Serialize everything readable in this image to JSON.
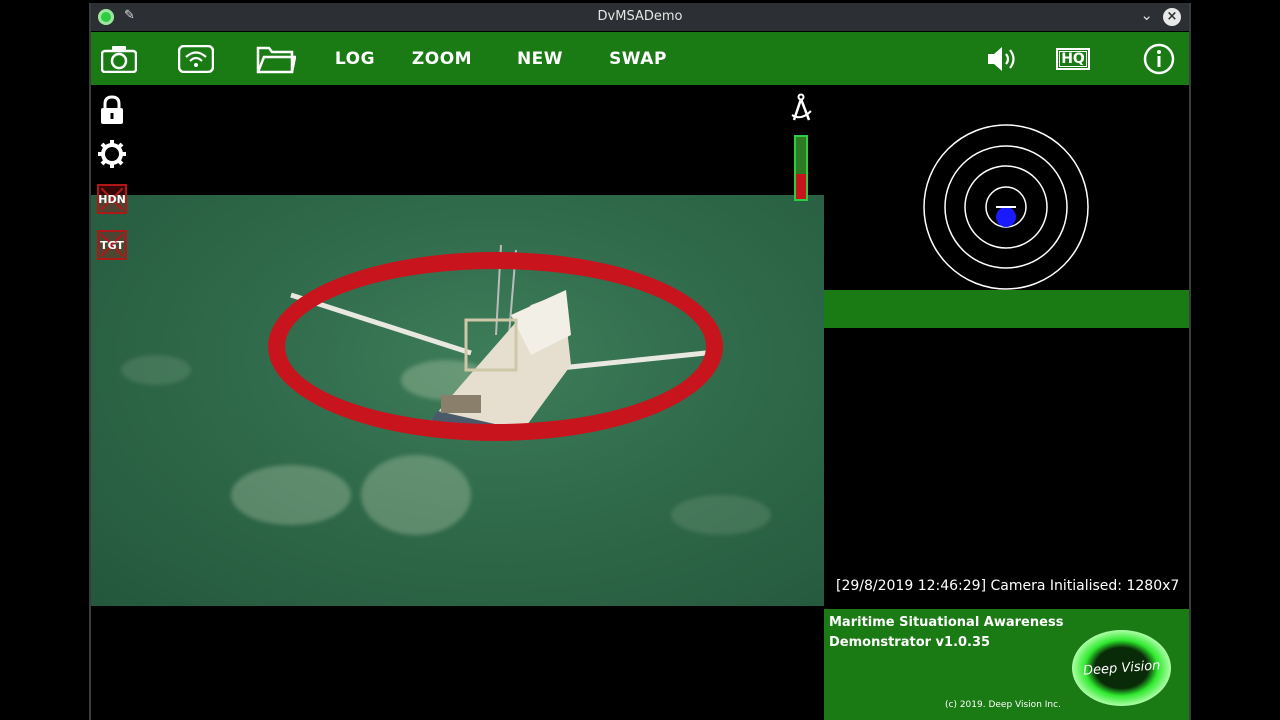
{
  "window": {
    "title": "DvMSADemo"
  },
  "toolbar": {
    "log": "LOG",
    "zoom": "ZOOM",
    "new": "NEW",
    "swap": "SWAP",
    "hq": "HQ"
  },
  "side_tools": {
    "hdn": "HDN",
    "tgt": "TGT"
  },
  "signal_level": 0.4,
  "status": {
    "message": "[29/8/2019 12:46:29] Camera Initialised: 1280x7"
  },
  "brand": {
    "title_line1": "Maritime Situational Awareness",
    "title_line2": "Demonstrator v1.0.35",
    "copyright": "(c) 2019. Deep Vision Inc.",
    "logo_text": "Deep Vision"
  },
  "colors": {
    "toolbar_green": "#1a7a14",
    "target_red": "#c8141c",
    "radar_blue": "#1a1aff"
  },
  "icons": [
    "app-icon",
    "pin-icon",
    "minimize-icon",
    "close-icon",
    "camera-icon",
    "wifi-icon",
    "folder-icon",
    "speaker-icon",
    "info-icon",
    "lock-icon",
    "gear-icon",
    "compass-icon"
  ]
}
